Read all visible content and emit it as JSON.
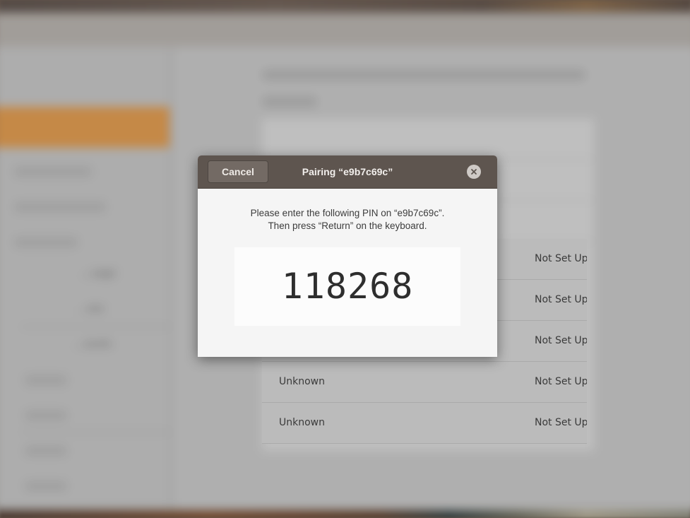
{
  "dialog": {
    "title": "Pairing “e9b7c69c”",
    "cancel_label": "Cancel",
    "close_icon": "close-icon",
    "instruction_line1": "Please enter the following PIN on “e9b7c69c”.",
    "instruction_line2": "Then press “Return” on the keyboard.",
    "pin": "118268"
  },
  "background": {
    "sidebar_labels": [
      "…uage",
      "…ess",
      "…ounts"
    ],
    "devices": [
      {
        "name": "",
        "status": "Not Set Up"
      },
      {
        "name": "",
        "status": "Not Set Up"
      },
      {
        "name": "",
        "status": "Not Set Up"
      },
      {
        "name": "Unknown",
        "status": "Not Set Up"
      },
      {
        "name": "Unknown",
        "status": "Not Set Up"
      }
    ]
  }
}
